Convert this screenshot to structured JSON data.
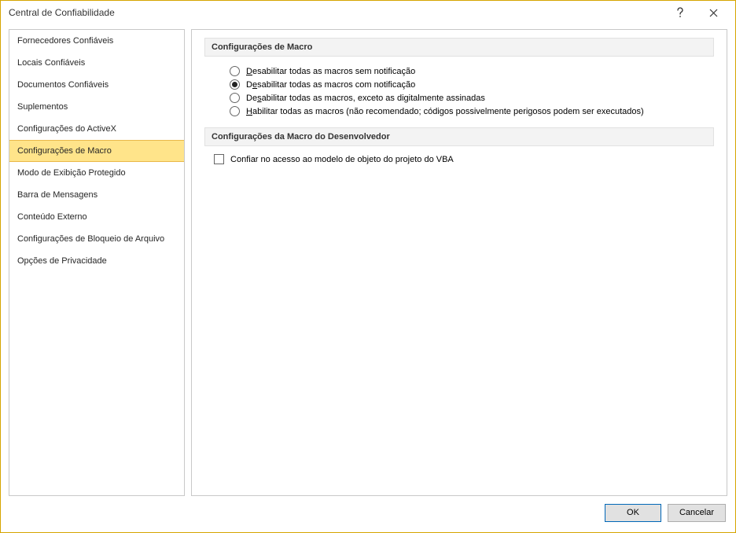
{
  "window": {
    "title": "Central de Confiabilidade"
  },
  "sidebar": {
    "items": [
      {
        "label": "Fornecedores Confiáveis"
      },
      {
        "label": "Locais Confiáveis"
      },
      {
        "label": "Documentos Confiáveis"
      },
      {
        "label": "Suplementos"
      },
      {
        "label": "Configurações do ActiveX"
      },
      {
        "label": "Configurações de Macro",
        "selected": true
      },
      {
        "label": "Modo de Exibição Protegido"
      },
      {
        "label": "Barra de Mensagens"
      },
      {
        "label": "Conteúdo Externo"
      },
      {
        "label": "Configurações de Bloqueio de Arquivo"
      },
      {
        "label": "Opções de Privacidade"
      }
    ]
  },
  "content": {
    "section1": {
      "header": "Configurações de Macro",
      "options": [
        {
          "u": "D",
          "rest": "esabilitar todas as macros sem notificação",
          "checked": false
        },
        {
          "pre": "D",
          "u": "e",
          "rest": "sabilitar todas as macros com notificação",
          "checked": true
        },
        {
          "pre": "De",
          "u": "s",
          "rest": "abilitar todas as macros, exceto as digitalmente assinadas",
          "checked": false
        },
        {
          "u": "H",
          "rest": "abilitar todas as macros (não recomendado; códigos possivelmente perigosos podem ser executados)",
          "checked": false
        }
      ]
    },
    "section2": {
      "header": "Configurações da Macro do Desenvolvedor",
      "checkbox": {
        "u": "C",
        "rest": "onfiar no acesso ao modelo de objeto do projeto do VBA",
        "checked": false
      }
    }
  },
  "footer": {
    "ok": "OK",
    "cancel": "Cancelar"
  }
}
